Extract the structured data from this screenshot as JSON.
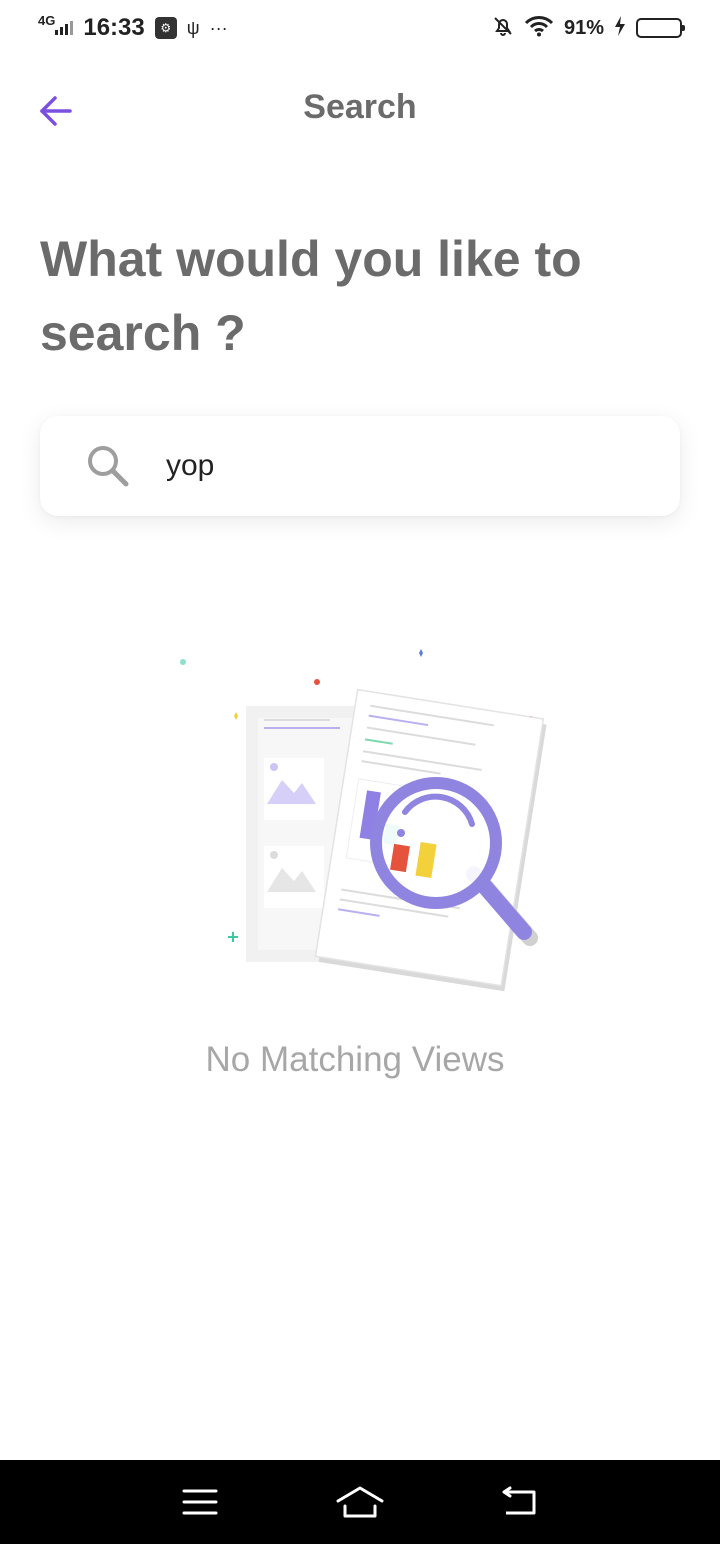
{
  "status_bar": {
    "network": "4G",
    "time": "16:33",
    "usb_label": "ψ",
    "more": "···",
    "battery_percent": "91%",
    "battery_level": 0.91
  },
  "app_bar": {
    "title": "Search",
    "back_icon": "arrow-left-icon",
    "accent_color": "#7b4fe0"
  },
  "heading": "What would you like to search ?",
  "search": {
    "value": "yop",
    "icon": "search-icon"
  },
  "empty_state": {
    "illustration": "document-magnifier-illustration",
    "message": "No Matching Views"
  },
  "nav_bar": {
    "menu_icon": "menu-icon",
    "home_icon": "home-icon",
    "back_icon": "back-icon"
  }
}
